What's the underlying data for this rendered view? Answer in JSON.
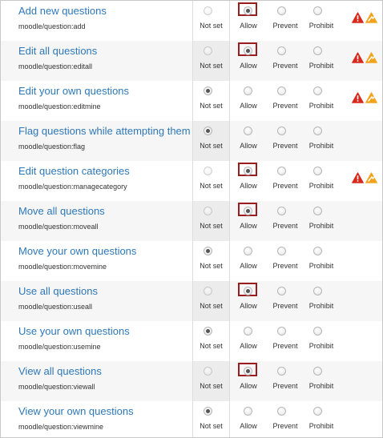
{
  "options": {
    "not_set": "Not set",
    "allow": "Allow",
    "prevent": "Prevent",
    "prohibit": "Prohibit"
  },
  "colors": {
    "link": "#2e78b8",
    "highlight_border": "#9b1c1c",
    "risk_red": "#d9281c",
    "risk_orange": "#f2a31c"
  },
  "capabilities": [
    {
      "title": "Add new questions",
      "path": "moodle/question:add",
      "selected": "allow",
      "highlighted": true,
      "risks": [
        "red-warning-icon",
        "orange-warning-icon"
      ]
    },
    {
      "title": "Edit all questions",
      "path": "moodle/question:editall",
      "selected": "allow",
      "highlighted": true,
      "risks": [
        "red-warning-icon",
        "orange-warning-icon"
      ]
    },
    {
      "title": "Edit your own questions",
      "path": "moodle/question:editmine",
      "selected": "not_set",
      "highlighted": false,
      "risks": [
        "red-warning-icon",
        "orange-warning-icon"
      ]
    },
    {
      "title": "Flag questions while attempting them",
      "path": "moodle/question:flag",
      "selected": "not_set",
      "highlighted": false,
      "risks": []
    },
    {
      "title": "Edit question categories",
      "path": "moodle/question:managecategory",
      "selected": "allow",
      "highlighted": true,
      "risks": [
        "red-warning-icon",
        "orange-warning-icon"
      ]
    },
    {
      "title": "Move all questions",
      "path": "moodle/question:moveall",
      "selected": "allow",
      "highlighted": true,
      "risks": []
    },
    {
      "title": "Move your own questions",
      "path": "moodle/question:movemine",
      "selected": "not_set",
      "highlighted": false,
      "risks": []
    },
    {
      "title": "Use all questions",
      "path": "moodle/question:useall",
      "selected": "allow",
      "highlighted": true,
      "risks": []
    },
    {
      "title": "Use your own questions",
      "path": "moodle/question:usemine",
      "selected": "not_set",
      "highlighted": false,
      "risks": []
    },
    {
      "title": "View all questions",
      "path": "moodle/question:viewall",
      "selected": "allow",
      "highlighted": true,
      "risks": []
    },
    {
      "title": "View your own questions",
      "path": "moodle/question:viewmine",
      "selected": "not_set",
      "highlighted": false,
      "risks": []
    }
  ]
}
